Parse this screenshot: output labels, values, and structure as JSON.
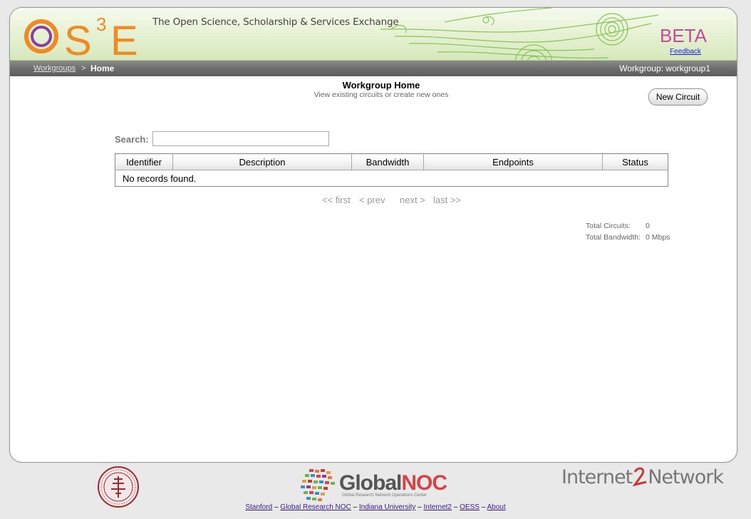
{
  "header": {
    "logo_text": "OS3E",
    "tagline": "The Open Science, Scholarship & Services Exchange",
    "beta_label": "BETA",
    "feedback_link": "Feedback"
  },
  "breadcrumb": {
    "parent": "Workgroups",
    "separator": ">",
    "current": "Home",
    "workgroup_label": "Workgroup: workgroup1"
  },
  "main": {
    "title": "Workgroup Home",
    "subtitle": "View existing circuits or create new ones",
    "new_circuit_button": "New Circuit",
    "search_label": "Search:",
    "search_value": "",
    "table": {
      "columns": [
        "Identifier",
        "Description",
        "Bandwidth",
        "Endpoints",
        "Status"
      ],
      "empty_message": "No records found."
    },
    "pager": {
      "first": "<< first",
      "prev": "< prev",
      "next": "next >",
      "last": "last >>"
    },
    "totals": {
      "circuits_label": "Total Circuits:",
      "circuits_value": "0",
      "bandwidth_label": "Total Bandwidth:",
      "bandwidth_value": "0 Mbps"
    }
  },
  "footer": {
    "globalnoc_name_a": "Global",
    "globalnoc_name_b": "NOC",
    "globalnoc_sub": "Global Research Network Operations Center",
    "internet2_a": "Internet",
    "internet2_b": "Network",
    "links": [
      "Stanford",
      "Global Research NOC",
      "Indiana University",
      "Internet2",
      "OESS",
      "About"
    ],
    "link_separator": "–"
  },
  "colors": {
    "beta": "#c44b9a",
    "logo_orange": "#f08a24",
    "logo_purple": "#8a3fa0",
    "banner_green": "#d6e8bc",
    "crumb_bar": "#6e6e6e",
    "stanford_red": "#a0282f"
  }
}
